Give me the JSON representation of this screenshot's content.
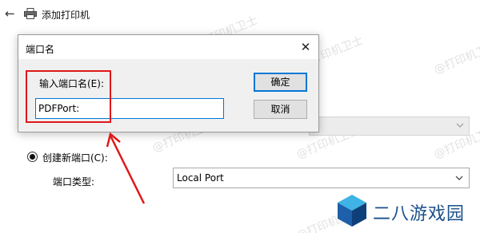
{
  "wizard": {
    "title": "添加打印机",
    "create_port_label": "创建新端口(C):",
    "port_type_label": "端口类型:",
    "port_type_value": "Local Port"
  },
  "dialog": {
    "title": "端口名",
    "input_label": "输入端口名(E):",
    "input_value": "PDFPort:",
    "ok_label": "确定",
    "cancel_label": "取消"
  },
  "watermark_text": "@打印机卫士",
  "brand": {
    "name": "二八游戏园"
  },
  "colors": {
    "accent": "#0078d7",
    "annotation": "#e01818",
    "brand_blue": "#1a4f8a"
  },
  "icons": [
    "back-arrow-icon",
    "printer-icon",
    "chevron-down-icon",
    "close-icon",
    "cube-logo-icon"
  ]
}
